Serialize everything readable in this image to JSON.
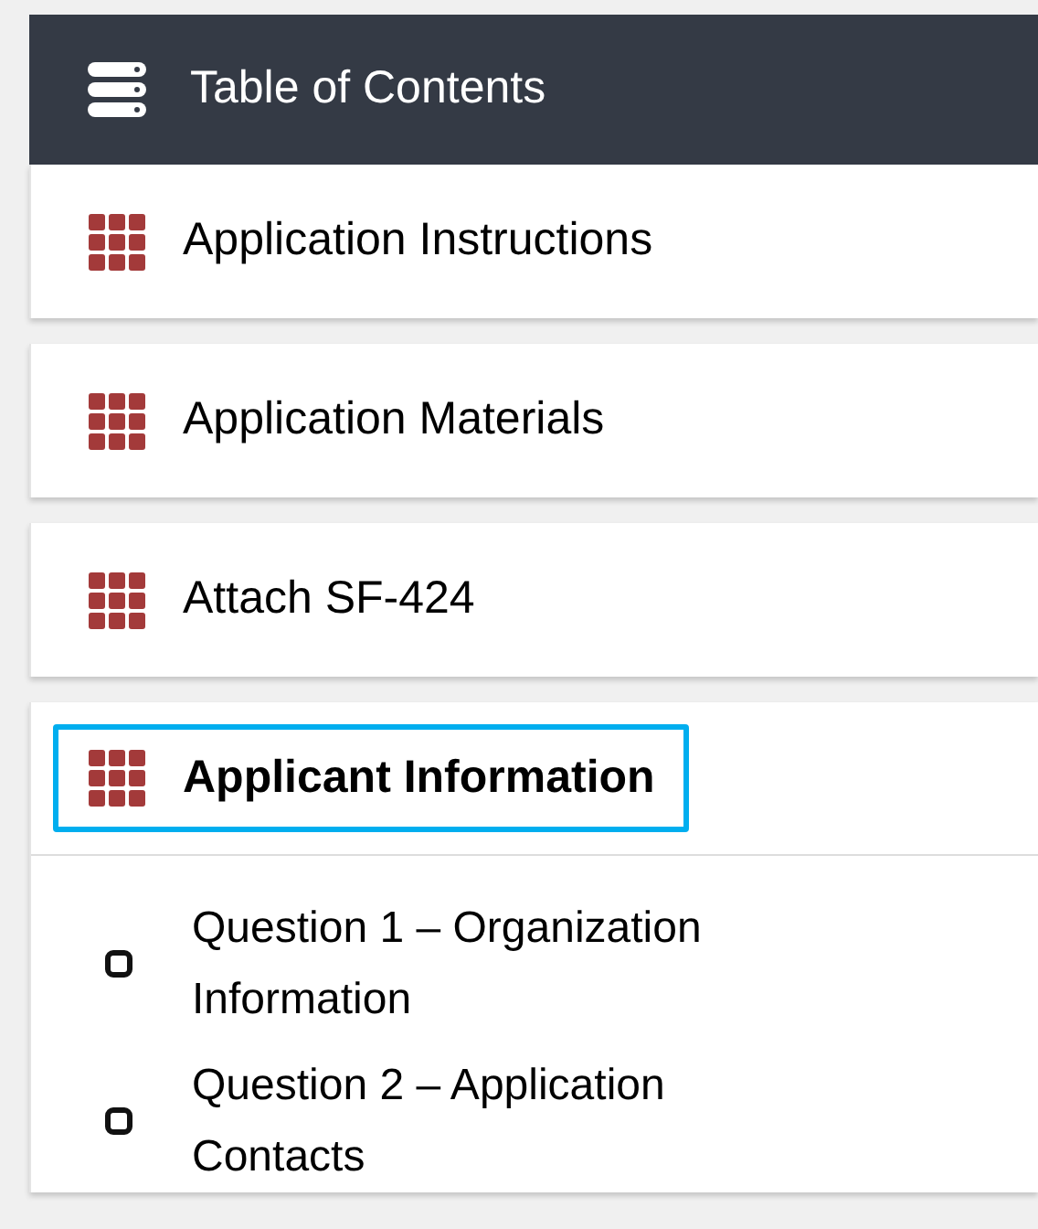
{
  "header": {
    "title": "Table of Contents"
  },
  "sections": [
    {
      "label": "Application Instructions",
      "selected": false,
      "expanded": false
    },
    {
      "label": "Application Materials",
      "selected": false,
      "expanded": false
    },
    {
      "label": "Attach SF-424",
      "selected": false,
      "expanded": false
    },
    {
      "label": "Applicant Information",
      "selected": true,
      "expanded": true,
      "children": [
        {
          "label": "Question 1 – Organization Information"
        },
        {
          "label": "Question 2 – Application Contacts"
        }
      ]
    }
  ]
}
